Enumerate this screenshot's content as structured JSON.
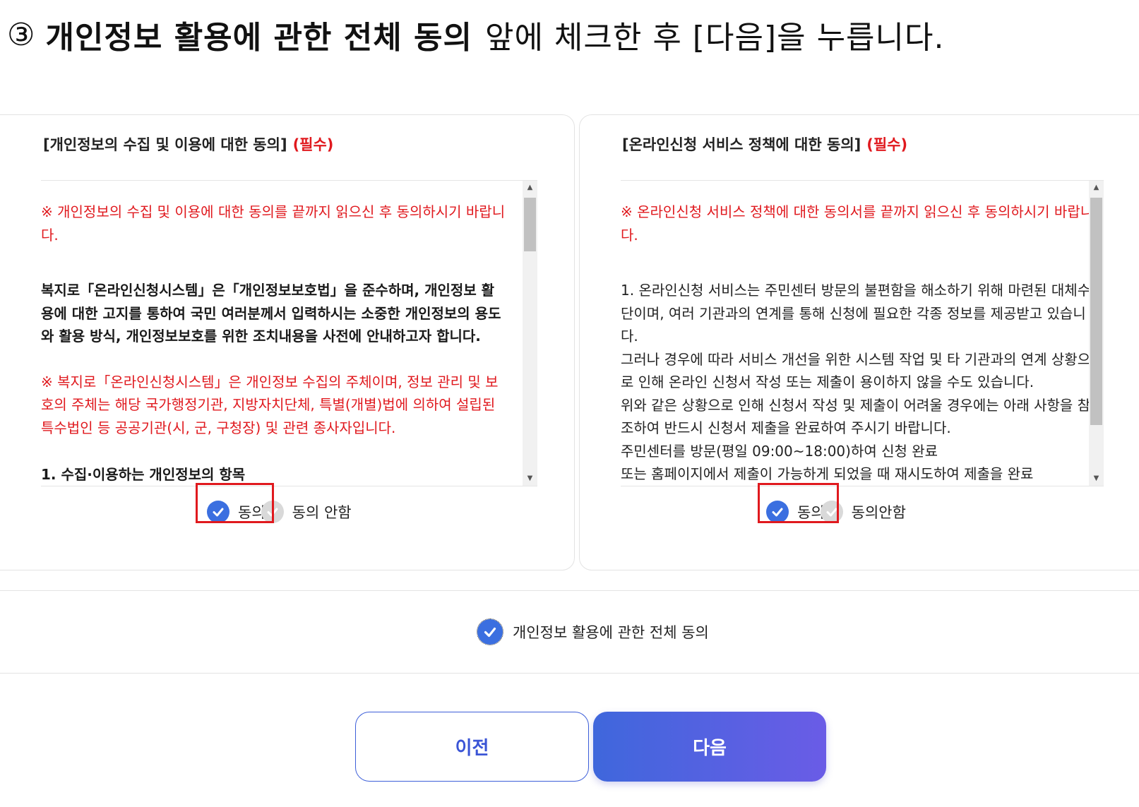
{
  "instruction": {
    "number": "③",
    "bold_text": "개인정보 활용에 관한 전체 동의",
    "rest_text": "앞에 체크한 후 [다음]을 누릅니다."
  },
  "left_card": {
    "title": "[개인정보의 수집 및 이용에 대한 동의]",
    "required": "(필수)",
    "notice": "※ 개인정보의 수집 및 이용에 대한 동의를 끝까지 읽으신 후 동의하시기 바랍니다.",
    "intro": "복지로「온라인신청시스템」은「개인정보보호법」을 준수하며, 개인정보 활용에 대한 고지를 통하여 국민 여러분께서 입력하시는 소중한 개인정보의 용도와 활용 방식, 개인정보보호를 위한 조치내용을 사전에 안내하고자 합니다.",
    "subject_notice": "※ 복지로「온라인신청시스템」은 개인정보 수집의 주체이며, 정보 관리 및 보호의 주체는 해당 국가행정기관, 지방자치단체, 특별(개별)법에 의하여 설립된 특수법인 등 공공기관(시, 군, 구청장) 및 관련 종사자입니다.",
    "section_heading": "1. 수집·이용하는 개인정보의 항목",
    "agree_label": "동의",
    "disagree_label": "동의 안함"
  },
  "right_card": {
    "title": "[온라인신청 서비스 정책에 대한 동의]",
    "required": "(필수)",
    "notice": "※ 온라인신청 서비스 정책에 대한 동의서를 끝까지 읽으신 후 동의하시기 바랍니다.",
    "paragraph_1": "1. 온라인신청 서비스는 주민센터 방문의 불편함을 해소하기 위해 마련된 대체수단이며, 여러 기관과의 연계를 통해 신청에 필요한 각종 정보를 제공받고 있습니다.",
    "paragraph_2": "그러나 경우에 따라 서비스 개선을 위한 시스템 작업 및 타 기관과의 연계 상황으로 인해 온라인 신청서 작성 또는 제출이 용이하지 않을 수도 있습니다.",
    "paragraph_3": "위와 같은 상황으로 인해 신청서 작성 및 제출이 어려울 경우에는 아래 사항을 참조하여 반드시 신청서 제출을 완료하여 주시기 바랍니다.",
    "paragraph_4": "주민센터를 방문(평일 09:00~18:00)하여 신청 완료",
    "paragraph_5": "또는 홈페이지에서 제출이 가능하게 되었을 때 재시도하여 제출을 완료",
    "agree_label": "동의",
    "disagree_label": "동의안함"
  },
  "agree_all": {
    "label": "개인정보 활용에 관한 전체 동의",
    "checked": true
  },
  "buttons": {
    "prev_label": "이전",
    "next_label": "다음"
  },
  "colors": {
    "accent_blue": "#3b6fe0",
    "required_red": "#e0191e",
    "next_gradient_start": "#3f67dc",
    "next_gradient_end": "#6a5ce6"
  }
}
